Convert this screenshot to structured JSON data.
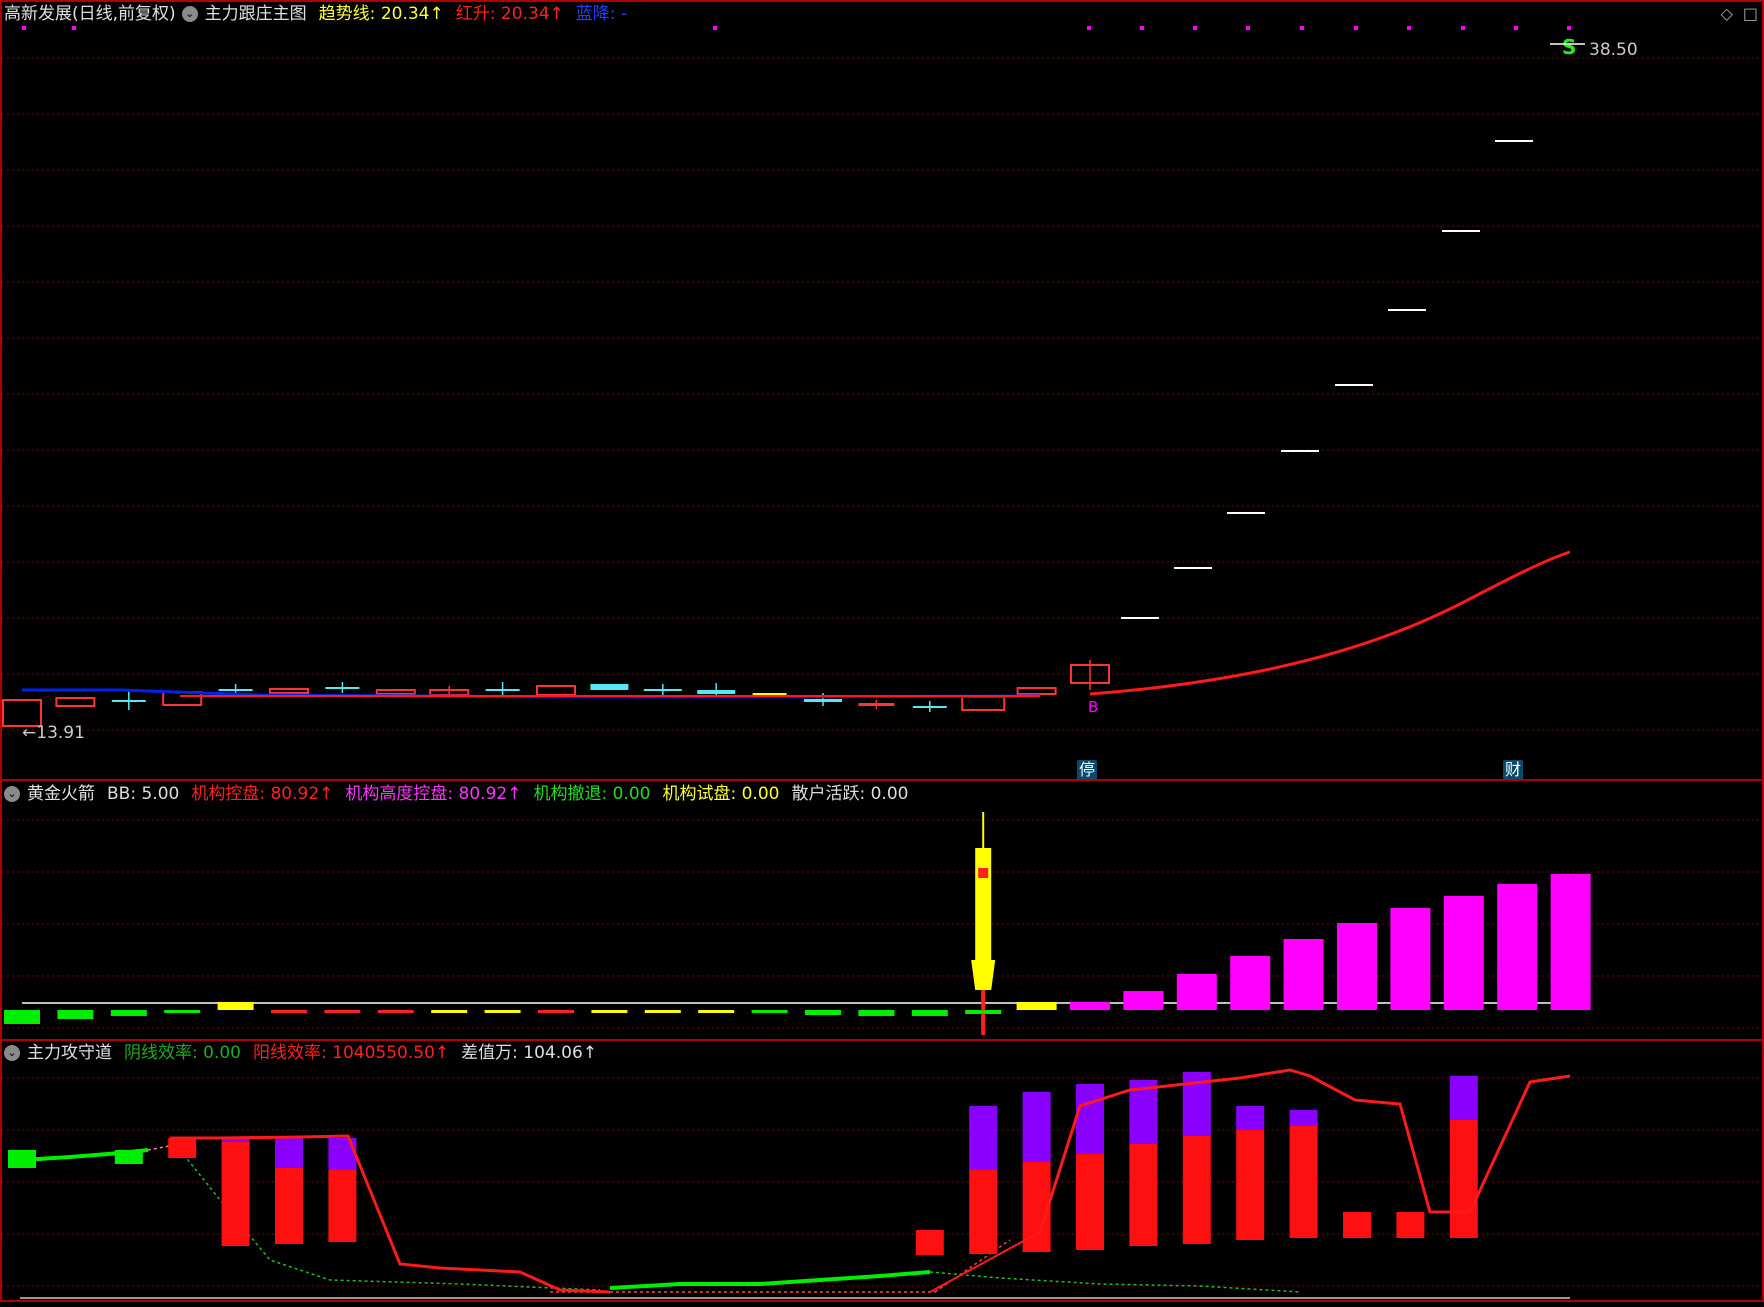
{
  "main_panel": {
    "title": "高新发展(日线,前复权)",
    "indicator_name": "主力跟庄主图",
    "legend": [
      {
        "label": "趋势线: ",
        "value": "20.34",
        "arrow": "↑",
        "color": "#ffff33"
      },
      {
        "label": "红升: ",
        "value": "20.34",
        "arrow": "↑",
        "color": "#ff2020"
      },
      {
        "label": "蓝降: ",
        "value": "-",
        "arrow": "",
        "color": "#2040ff"
      }
    ],
    "high_label": "38.50",
    "low_label": "13.91",
    "low_arrow": "←",
    "high_marker": "S",
    "buy_marker": "B",
    "badge_limit_up": "停",
    "badge_finance": "财",
    "icons": [
      "diamond-icon",
      "square-icon"
    ]
  },
  "sub_panel_1": {
    "indicator_name": "黄金火箭",
    "legend": [
      {
        "label": "BB: ",
        "value": "5.00",
        "arrow": "",
        "color": "#dddddd"
      },
      {
        "label": "机构控盘: ",
        "value": "80.92",
        "arrow": "↑",
        "color": "#ff2020"
      },
      {
        "label": "机构高度控盘: ",
        "value": "80.92",
        "arrow": "↑",
        "color": "#ff33ff"
      },
      {
        "label": "机构撤退: ",
        "value": "0.00",
        "arrow": "",
        "color": "#22dd22"
      },
      {
        "label": "机构试盘: ",
        "value": "0.00",
        "arrow": "",
        "color": "#ffff33"
      },
      {
        "label": "散户活跃: ",
        "value": "0.00",
        "arrow": "",
        "color": "#dddddd"
      }
    ]
  },
  "sub_panel_2": {
    "indicator_name": "主力攻守道",
    "legend": [
      {
        "label": "阴线效率: ",
        "value": "0.00",
        "arrow": "",
        "color": "#22aa22"
      },
      {
        "label": "阳线效率: ",
        "value": "1040550.50",
        "arrow": "↑",
        "color": "#ff2020"
      },
      {
        "label": "差值万: ",
        "value": "104.06",
        "arrow": "↑",
        "color": "#dddddd"
      }
    ]
  },
  "colors": {
    "background": "#000000",
    "grid": "#7a0000",
    "border": "#b00000",
    "up": "#ff3333",
    "down": "#55e8f0",
    "trend_red": "#ff1a1a",
    "trend_blue": "#0022ee",
    "magenta": "#ff00ff",
    "yellow": "#ffff00",
    "green": "#00ee00",
    "purple": "#8a00ff"
  }
}
